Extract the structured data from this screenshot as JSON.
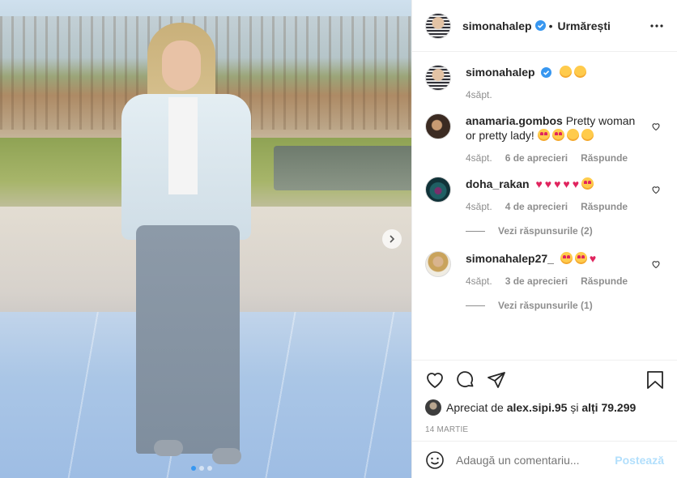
{
  "header": {
    "username": "simonahalep",
    "follow_status": "Urmărești",
    "separator": "•"
  },
  "caption": {
    "username": "simonahalep",
    "emojis": [
      "smiling-face-emoji",
      "upside-down-face-emoji"
    ],
    "time": "4săpt."
  },
  "comments": [
    {
      "username": "anamaria.gombos",
      "text": "Pretty woman or pretty lady!",
      "emojis": [
        "smiling-face-with-hearts-emoji",
        "smiling-face-with-hearts-emoji",
        "face-blowing-kiss-emoji",
        "face-savoring-emoji"
      ],
      "time": "4săpt.",
      "likes": "6 de aprecieri",
      "reply": "Răspunde"
    },
    {
      "username": "doha_rakan",
      "text": "",
      "emojis": [
        "red-heart-emoji",
        "red-heart-emoji",
        "red-heart-emoji",
        "red-heart-emoji",
        "red-heart-emoji",
        "heart-eyes-emoji"
      ],
      "time": "4săpt.",
      "likes": "4 de aprecieri",
      "reply": "Răspunde",
      "view_replies": "Vezi răspunsurile (2)"
    },
    {
      "username": "simonahalep27_",
      "text": "",
      "emojis": [
        "heart-eyes-emoji",
        "heart-eyes-emoji",
        "red-heart-emoji"
      ],
      "time": "4săpt.",
      "likes": "3 de aprecieri",
      "reply": "Răspunde",
      "view_replies": "Vezi răspunsurile (1)"
    }
  ],
  "likes": {
    "prefix": "Apreciat de",
    "user": "alex.sipi.95",
    "and": "și",
    "others": "alți 79.299"
  },
  "date": "14 MARTIE",
  "add_comment": {
    "placeholder": "Adaugă un comentariu...",
    "post_label": "Postează"
  },
  "carousel": {
    "count": 3,
    "active_index": 0
  },
  "colors": {
    "verified": "#3897f0",
    "text": "#262626",
    "muted": "#8e8e8e",
    "post_disabled": "#b2dffc"
  }
}
